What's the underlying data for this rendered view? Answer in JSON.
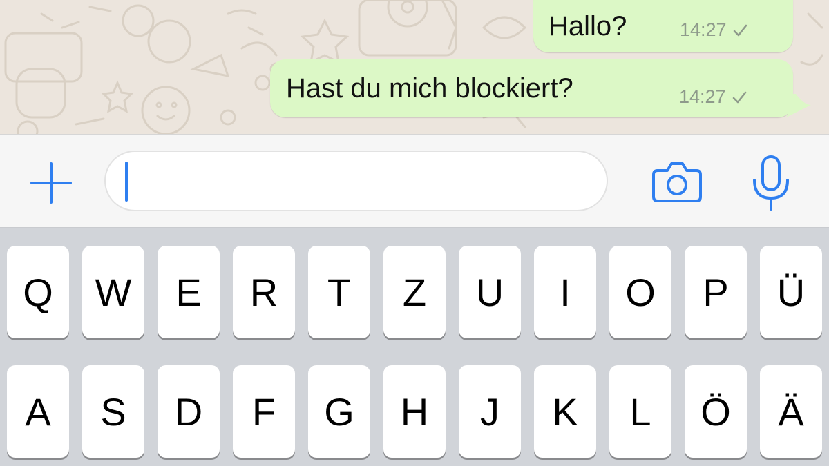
{
  "chat": {
    "messages": [
      {
        "text": "Hallo?",
        "time": "14:27",
        "status": "sent-single-check"
      },
      {
        "text": "Hast du mich blockiert?",
        "time": "14:27",
        "status": "sent-single-check"
      }
    ]
  },
  "input": {
    "placeholder": "",
    "value": "",
    "icons": {
      "attach": "plus-icon",
      "camera": "camera-icon",
      "mic": "microphone-icon"
    }
  },
  "keyboard": {
    "row1": [
      "Q",
      "W",
      "E",
      "R",
      "T",
      "Z",
      "U",
      "I",
      "O",
      "P",
      "Ü"
    ],
    "row2": [
      "A",
      "S",
      "D",
      "F",
      "G",
      "H",
      "J",
      "K",
      "L",
      "Ö",
      "Ä"
    ]
  },
  "colors": {
    "accent": "#2f7ff0",
    "bubble_out": "#dcf8c6",
    "chat_bg": "#ece5dd",
    "keyboard_bg": "#d1d4d9"
  }
}
